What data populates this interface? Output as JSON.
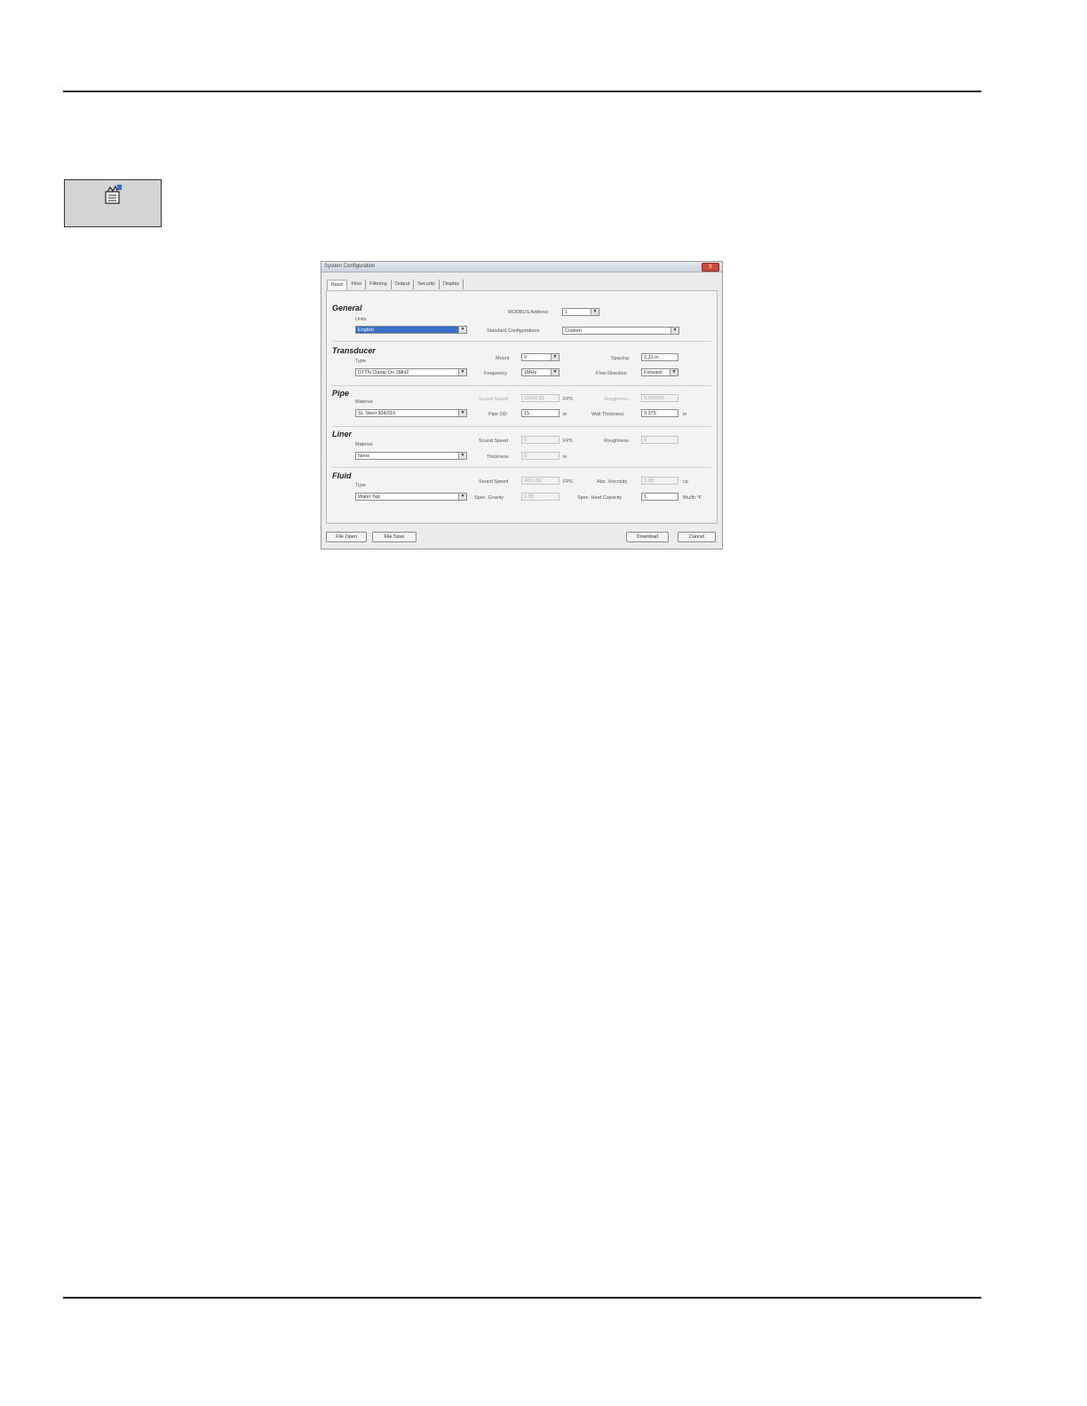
{
  "dialog": {
    "title": "System Configuration",
    "close_label": "X",
    "tabs": [
      "Basic",
      "Flow",
      "Filtering",
      "Output",
      "Security",
      "Display"
    ],
    "general": {
      "title": "General",
      "units_label": "Units",
      "units_value": "English",
      "modbus_label": "MODBUS Address",
      "modbus_value": "1",
      "standard_config_label": "Standard Configurations",
      "standard_config_value": "Custom"
    },
    "transducer": {
      "title": "Transducer",
      "type_label": "Type",
      "type_value": "DTTN Clamp On 1MHZ",
      "mount_label": "Mount",
      "mount_value": "V",
      "spacing_label": "Spacing",
      "spacing_value": "2.31 in",
      "frequency_label": "Frequency",
      "frequency_value": "1MHz",
      "flow_direction_label": "Flow Direction",
      "flow_direction_value": "Forward"
    },
    "pipe": {
      "title": "Pipe",
      "material_label": "Material",
      "material_value": "St. Steel 304/316",
      "sound_speed_label": "Sound Speed",
      "sound_speed_value": "10032.81",
      "sound_speed_unit": "FPS",
      "roughness_label": "Roughness",
      "roughness_value": "0.000150",
      "pipe_od_label": "Pipe OD",
      "pipe_od_value": "15",
      "pipe_od_unit": "in",
      "wall_label": "Wall Thickness",
      "wall_value": "0.375",
      "wall_unit": "in"
    },
    "liner": {
      "title": "Liner",
      "material_label": "Material",
      "material_value": "None",
      "sound_speed_label": "Sound Speed",
      "sound_speed_value": "0",
      "sound_speed_unit": "FPS",
      "roughness_label": "Roughness",
      "roughness_value": "0",
      "thickness_label": "Thickness",
      "thickness_value": "0",
      "thickness_unit": "in"
    },
    "fluid": {
      "title": "Fluid",
      "type_label": "Type",
      "type_value": "Water Tap",
      "sound_speed_label": "Sound Speed",
      "sound_speed_value": "4911.32",
      "sound_speed_unit": "FPS",
      "viscosity_label": "Abs. Viscosity",
      "viscosity_value": "1.00",
      "viscosity_unit": "cp",
      "gravity_label": "Spec. Gravity",
      "gravity_value": "1.00",
      "heat_label": "Spec. Heat Capacity",
      "heat_value": "1",
      "heat_unit": "Btu/lb °F"
    },
    "buttons": {
      "file_open": "File Open",
      "file_save": "File Save",
      "download": "Download",
      "cancel": "Cancel"
    }
  }
}
